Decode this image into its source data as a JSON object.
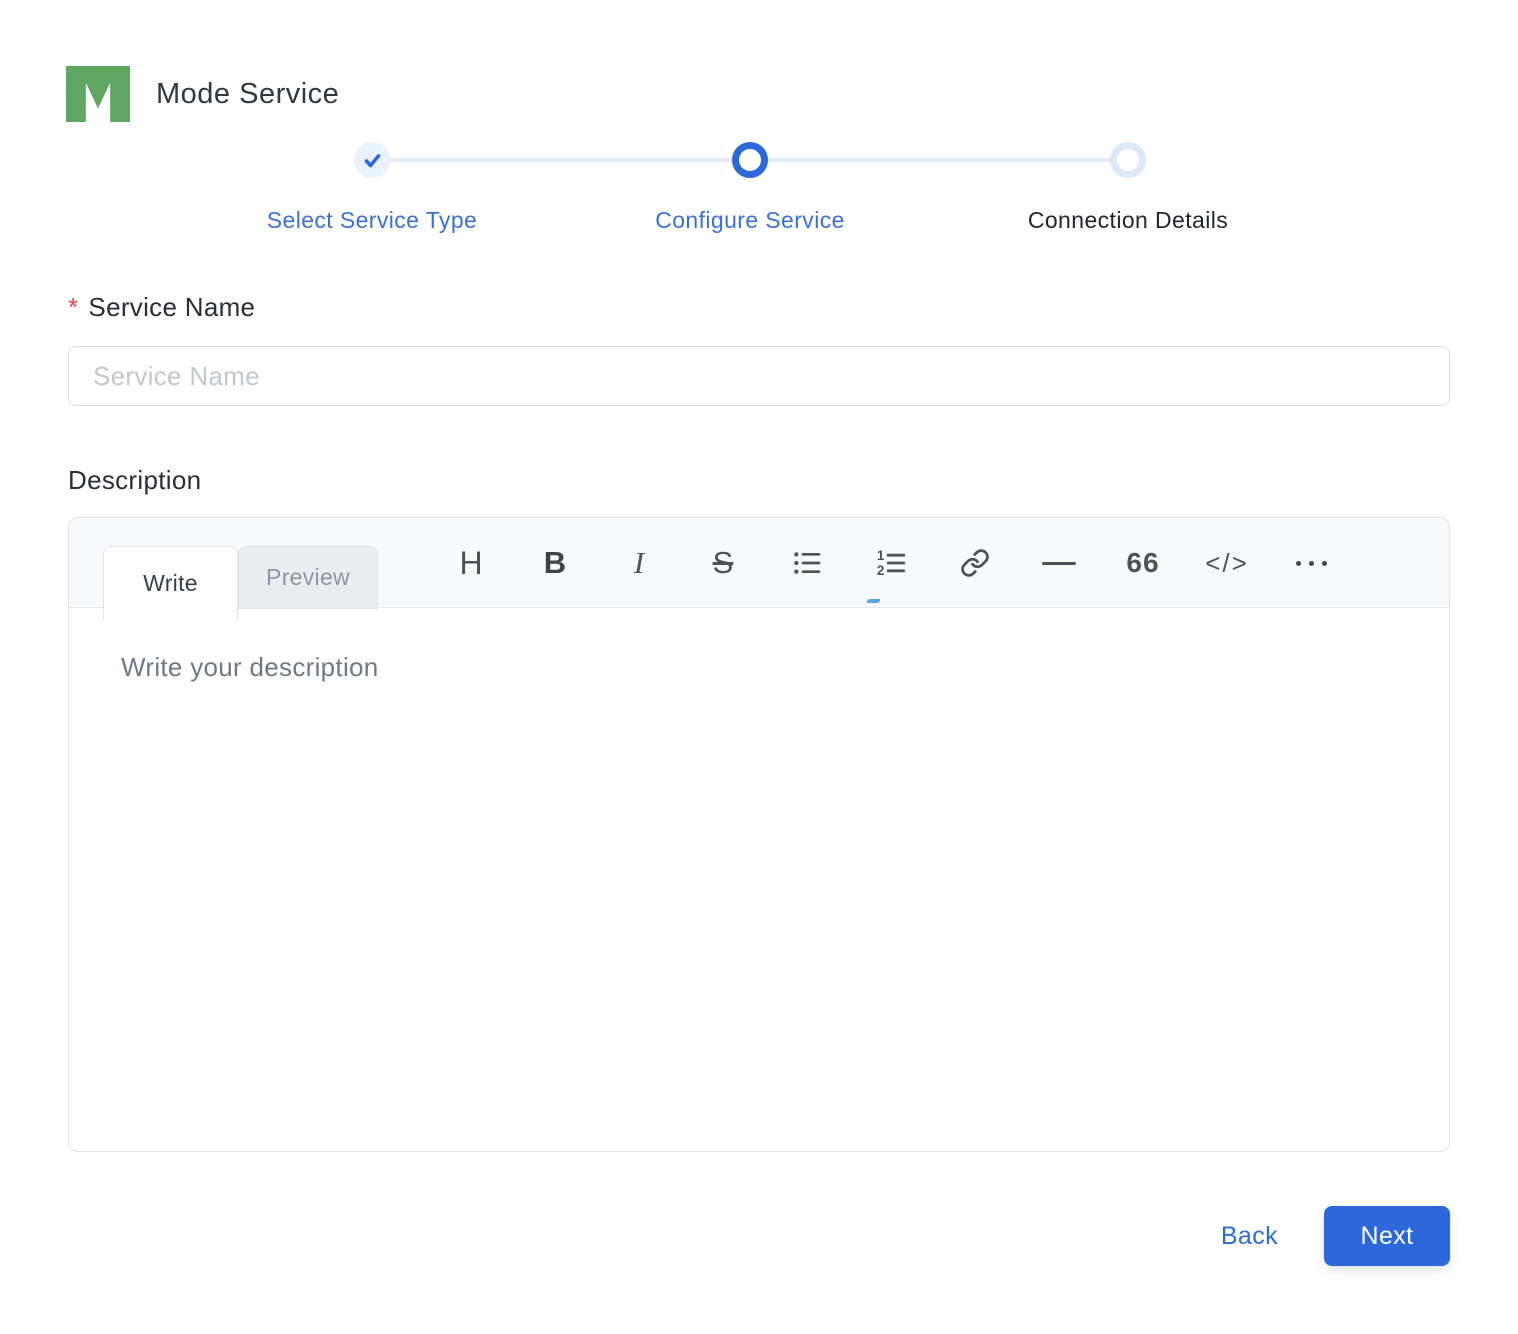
{
  "header": {
    "title": "Mode Service"
  },
  "stepper": {
    "steps": [
      {
        "label": "Select Service Type",
        "state": "completed"
      },
      {
        "label": "Configure Service",
        "state": "active"
      },
      {
        "label": "Connection Details",
        "state": "upcoming"
      }
    ]
  },
  "form": {
    "service_name": {
      "required_marker": "*",
      "label": "Service Name",
      "placeholder": "Service Name",
      "value": ""
    },
    "description": {
      "label": "Description",
      "tabs": {
        "write": "Write",
        "preview": "Preview"
      },
      "toolbar": {
        "icons": [
          "heading",
          "bold",
          "italic",
          "strikethrough",
          "unordered-list",
          "ordered-list",
          "link",
          "horizontal-rule",
          "quote",
          "code",
          "more-options"
        ],
        "heading_glyph": "H",
        "bold_glyph": "B",
        "italic_glyph": "I",
        "strikethrough_glyph": "S",
        "ordered_list_numbers": [
          "1",
          "2"
        ],
        "quote_glyph": "66",
        "code_glyph": "</>"
      },
      "placeholder": "Write your description",
      "value": ""
    }
  },
  "footer": {
    "back_label": "Back",
    "next_label": "Next"
  },
  "colors": {
    "primary_blue": "#2d68da",
    "step_label_blue": "#3b6fdb",
    "logo_green": "#5fa763",
    "completed_circle_bg": "#e9f1fc",
    "upcoming_ring": "#dce9fa",
    "connector": "#e6ecf7",
    "asterisk_red": "#e5484d",
    "toolbar_bg": "#f8f9fb",
    "border_gray": "#d9dce1"
  }
}
